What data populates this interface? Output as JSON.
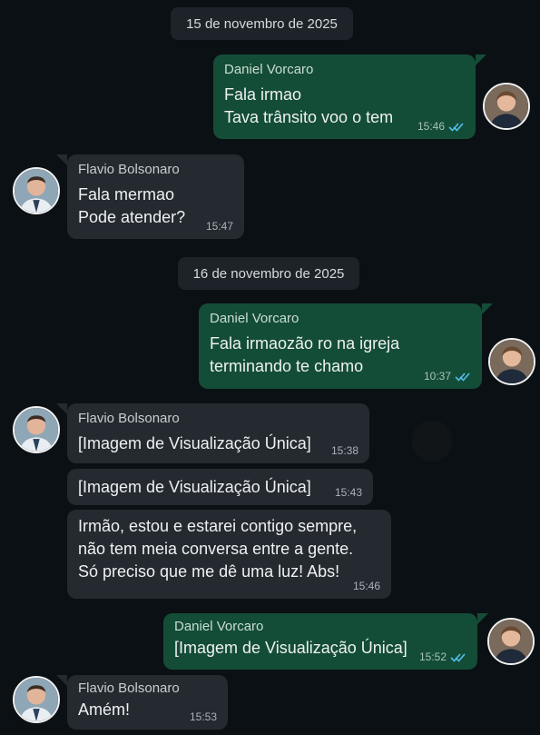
{
  "dates": [
    "15 de novembro de 2025",
    "16 de novembro de 2025"
  ],
  "messages": [
    {
      "sender": "Daniel Vorcaro",
      "lines": [
        "Fala irmao",
        "Tava trânsito voo o tem"
      ],
      "time": "15:46"
    },
    {
      "sender": "Flavio Bolsonaro",
      "lines": [
        "Fala mermao",
        "Pode atender?"
      ],
      "time": "15:47"
    },
    {
      "sender": "Daniel Vorcaro",
      "lines": [
        "Fala irmaozão ro na igreja",
        "terminando te chamo"
      ],
      "time": "10:37"
    },
    {
      "sender": "Flavio Bolsonaro",
      "lines": [
        "[Imagem de Visualização Única]"
      ],
      "time": "15:38"
    },
    {
      "lines": [
        "[Imagem de Visualização Única]"
      ],
      "time": "15:43"
    },
    {
      "lines": [
        "Irmão, estou e estarei contigo sempre,",
        "não tem meia conversa entre a gente.",
        "Só preciso que me dê uma luz! Abs!"
      ],
      "time": "15:46"
    },
    {
      "sender": "Daniel Vorcaro",
      "lines": [
        "[Imagem de Visualização Única]"
      ],
      "time": "15:52"
    },
    {
      "sender": "Flavio Bolsonaro",
      "lines": [
        "Amém!"
      ],
      "time": "15:53"
    }
  ],
  "colors": {
    "background": "#0b1014",
    "outgoing_bubble": "#144d37",
    "incoming_bubble": "#242a2f",
    "read_ticks": "#53bdeb"
  },
  "icons": {
    "read_receipt": "double-check-icon"
  }
}
